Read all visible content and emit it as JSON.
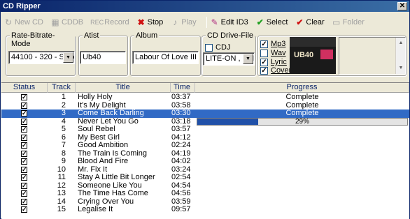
{
  "window": {
    "title": "CD Ripper",
    "close_glyph": "✕"
  },
  "toolbar": {
    "new_cd": "New CD",
    "cddb": "CDDB",
    "record": "Record",
    "record_prefix": "REC",
    "stop": "Stop",
    "play": "Play",
    "edit_id3": "Edit ID3",
    "select": "Select",
    "clear": "Clear",
    "folder": "Folder"
  },
  "settings": {
    "rate_label": "Rate-Bitrate-Mode",
    "rate_value": "44100 - 320 - Stereo",
    "artist_label": "Atist",
    "artist_value": "Ub40",
    "album_label": "Album",
    "album_value": "Labour Of Love III",
    "drive_label": "CD Drive-File",
    "cdj_label": "CDJ",
    "drive_value": "LITE-ON , DVD"
  },
  "formats": {
    "mp3": "Mp3",
    "wav": "Wav",
    "lyric": "Lyric",
    "cover": "Cover"
  },
  "cover": {
    "text": "UB40"
  },
  "table": {
    "headers": {
      "status": "Status",
      "track": "Track",
      "title": "Title",
      "time": "Time",
      "progress": "Progress"
    },
    "rows": [
      {
        "track": "1",
        "title": "Holly Holy",
        "time": "03:37",
        "progress": "Complete"
      },
      {
        "track": "2",
        "title": "It's My Delight",
        "time": "03:58",
        "progress": "Complete"
      },
      {
        "track": "3",
        "title": "Come Back Darling",
        "time": "03:30",
        "progress": "Complete"
      },
      {
        "track": "4",
        "title": "Never Let You Go",
        "time": "03:18",
        "progress": "29%"
      },
      {
        "track": "5",
        "title": "Soul Rebel",
        "time": "03:57",
        "progress": ""
      },
      {
        "track": "6",
        "title": "My Best Girl",
        "time": "04:12",
        "progress": ""
      },
      {
        "track": "7",
        "title": "Good Ambition",
        "time": "02:24",
        "progress": ""
      },
      {
        "track": "8",
        "title": "The Train Is Coming",
        "time": "04:19",
        "progress": ""
      },
      {
        "track": "9",
        "title": "Blood And Fire",
        "time": "04:02",
        "progress": ""
      },
      {
        "track": "10",
        "title": "Mr. Fix It",
        "time": "03:24",
        "progress": ""
      },
      {
        "track": "11",
        "title": "Stay A Little Bit Longer",
        "time": "02:54",
        "progress": ""
      },
      {
        "track": "12",
        "title": "Someone Like You",
        "time": "04:54",
        "progress": ""
      },
      {
        "track": "13",
        "title": "The Time Has Come",
        "time": "04:56",
        "progress": ""
      },
      {
        "track": "14",
        "title": "Crying Over You",
        "time": "03:59",
        "progress": ""
      },
      {
        "track": "15",
        "title": "Legalise It",
        "time": "09:57",
        "progress": ""
      }
    ]
  },
  "current_progress_fraction": 0.29,
  "selected_track": "3",
  "check_glyph": "✓",
  "colors": {
    "selection": "#316ac5",
    "title_bar": "#0a246a",
    "progress_fill": "#2050a8"
  },
  "icons": [
    "new-cd-icon",
    "cddb-icon",
    "record-icon",
    "stop-icon",
    "play-icon",
    "edit-id3-icon",
    "select-icon",
    "clear-icon",
    "folder-icon"
  ]
}
